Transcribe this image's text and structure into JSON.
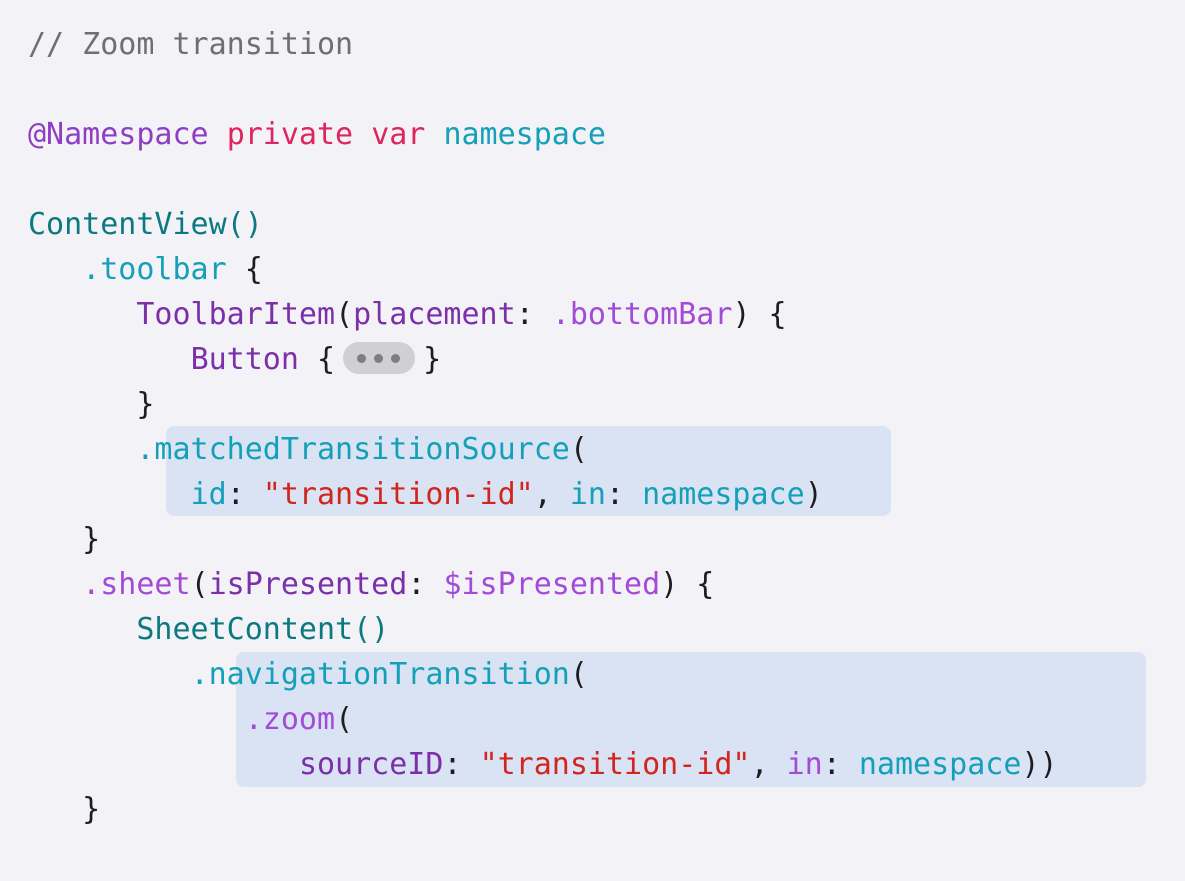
{
  "code": {
    "comment": "// Zoom transition",
    "namespace_line": [
      "@Namespace",
      "private",
      "var",
      "namespace"
    ],
    "content_view": "ContentView()",
    "toolbar": ".toolbar",
    "toolbar_item": "ToolbarItem",
    "placement_label": "placement",
    "bottom_bar": ".bottomBar",
    "button": "Button",
    "matched_source": ".matchedTransitionSource",
    "id_label": "id",
    "transition_id": "\"transition-id\"",
    "in_label": "in",
    "namespace_ident": "namespace",
    "sheet": ".sheet",
    "is_presented_label": "isPresented",
    "is_presented_value": "$isPresented",
    "sheet_content": "SheetContent()",
    "navigation_transition": ".navigationTransition",
    "zoom": ".zoom",
    "source_id_label": "sourceID"
  }
}
